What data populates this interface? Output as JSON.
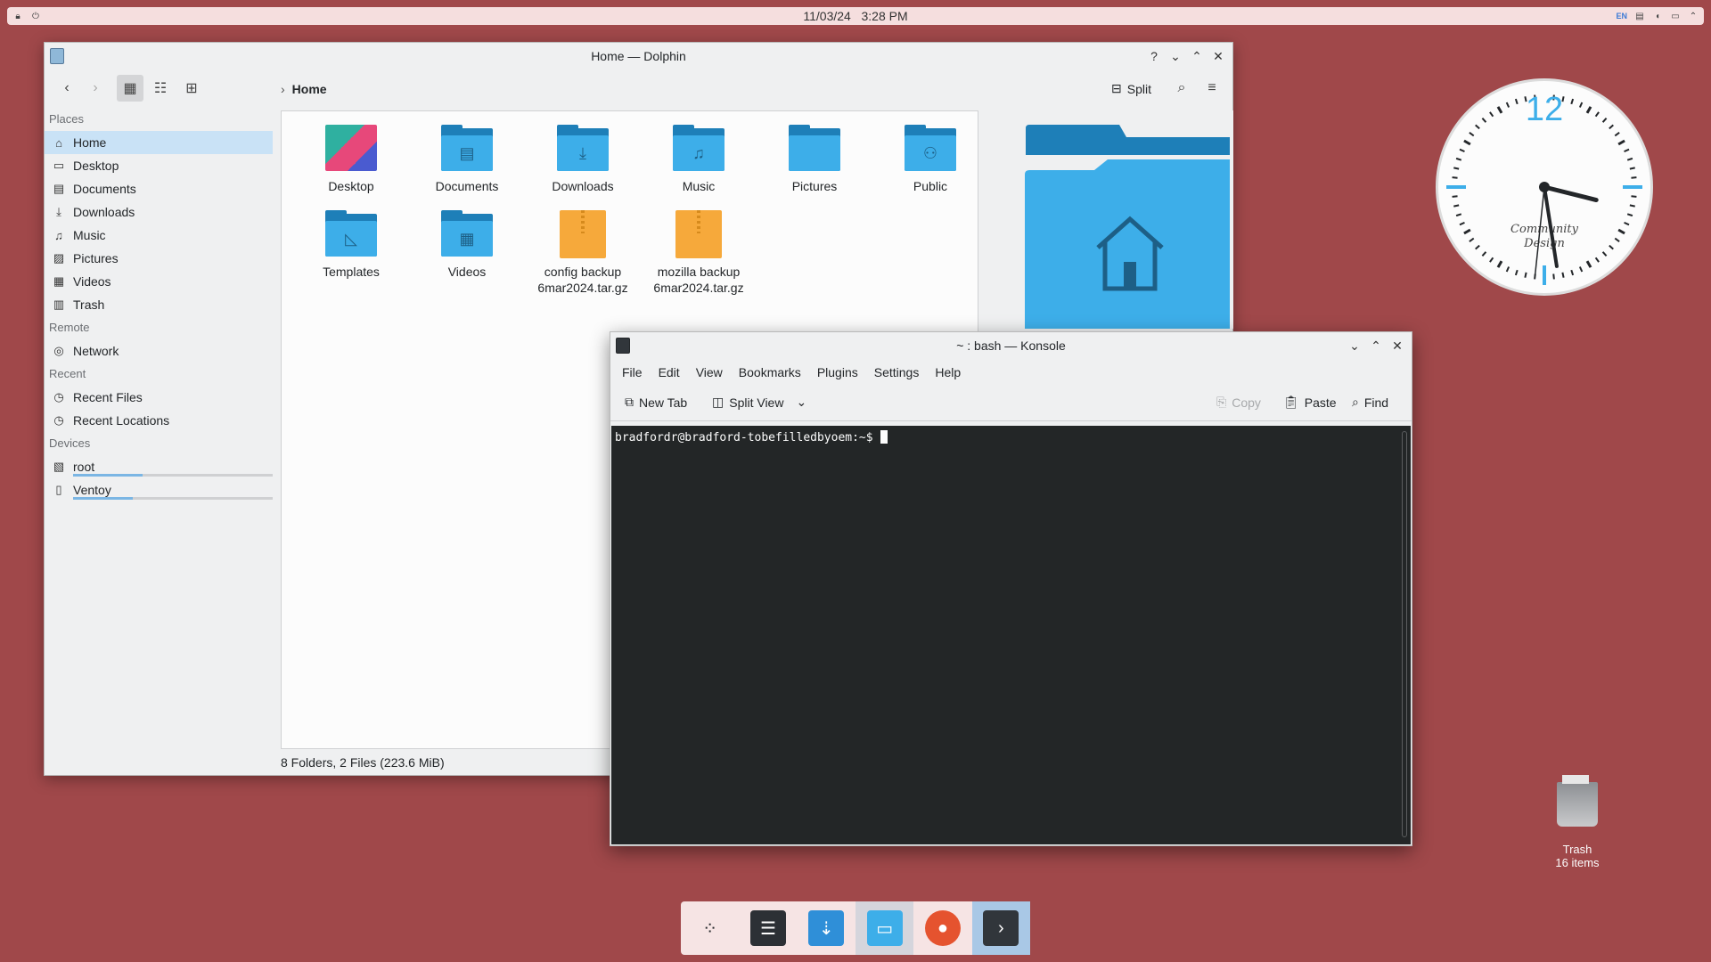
{
  "top_panel": {
    "date": "11/03/24",
    "time": "3:28 PM",
    "lang": "EN"
  },
  "dolphin": {
    "title": "Home — Dolphin",
    "breadcrumb": "Home",
    "split_label": "Split",
    "status": "8 Folders, 2 Files (223.6 MiB)",
    "sidebar": {
      "places_title": "Places",
      "places": [
        {
          "label": "Home",
          "icon": "home-icon"
        },
        {
          "label": "Desktop",
          "icon": "desktop-icon"
        },
        {
          "label": "Documents",
          "icon": "documents-icon"
        },
        {
          "label": "Downloads",
          "icon": "downloads-icon"
        },
        {
          "label": "Music",
          "icon": "music-icon"
        },
        {
          "label": "Pictures",
          "icon": "pictures-icon"
        },
        {
          "label": "Videos",
          "icon": "videos-icon"
        },
        {
          "label": "Trash",
          "icon": "trash-icon"
        }
      ],
      "remote_title": "Remote",
      "remote": [
        {
          "label": "Network",
          "icon": "network-icon"
        }
      ],
      "recent_title": "Recent",
      "recent": [
        {
          "label": "Recent Files",
          "icon": "recent-files-icon"
        },
        {
          "label": "Recent Locations",
          "icon": "recent-locations-icon"
        }
      ],
      "devices_title": "Devices",
      "devices": [
        {
          "label": "root",
          "icon": "drive-icon",
          "usage": 0.35
        },
        {
          "label": "Ventoy",
          "icon": "usb-drive-icon",
          "usage": 0.3
        }
      ]
    },
    "files": [
      {
        "label": "Desktop",
        "type": "desktop"
      },
      {
        "label": "Documents",
        "type": "folder",
        "glyph": "▤"
      },
      {
        "label": "Downloads",
        "type": "folder",
        "glyph": "⤓"
      },
      {
        "label": "Music",
        "type": "folder",
        "glyph": "♫"
      },
      {
        "label": "Pictures",
        "type": "pictures"
      },
      {
        "label": "Public",
        "type": "folder",
        "glyph": "⚇"
      },
      {
        "label": "Templates",
        "type": "folder",
        "glyph": "◺"
      },
      {
        "label": "Videos",
        "type": "folder",
        "glyph": "▦"
      },
      {
        "label": "config backup 6mar2024.tar.gz",
        "type": "archive"
      },
      {
        "label": "mozilla backup 6mar2024.tar.gz",
        "type": "archive"
      }
    ]
  },
  "konsole": {
    "title": "~ : bash — Konsole",
    "menu": [
      "File",
      "Edit",
      "View",
      "Bookmarks",
      "Plugins",
      "Settings",
      "Help"
    ],
    "new_tab": "New Tab",
    "split_view": "Split View",
    "copy": "Copy",
    "paste": "Paste",
    "find": "Find",
    "prompt": "bradfordr@bradford-tobefilledbyoem:~$"
  },
  "clock": {
    "twelve": "12",
    "brand_line1": "Community",
    "brand_line2": "Design",
    "hour": 15,
    "minute": 28,
    "second": 31
  },
  "desktop_trash": {
    "label": "Trash",
    "count": "16 items"
  },
  "taskbar": [
    {
      "name": "app-launcher-icon",
      "color": "#232629",
      "glyph": "⁘"
    },
    {
      "name": "system-settings-icon",
      "color": "#2c3035",
      "glyph": "☰"
    },
    {
      "name": "discover-store-icon",
      "color": "#2f8fd8",
      "glyph": "⇣"
    },
    {
      "name": "dolphin-files-icon",
      "color": "#3daee9",
      "glyph": "▭"
    },
    {
      "name": "firefox-icon",
      "color": "#e5532f",
      "glyph": "●"
    },
    {
      "name": "konsole-icon",
      "color": "#31363b",
      "glyph": "›"
    }
  ]
}
